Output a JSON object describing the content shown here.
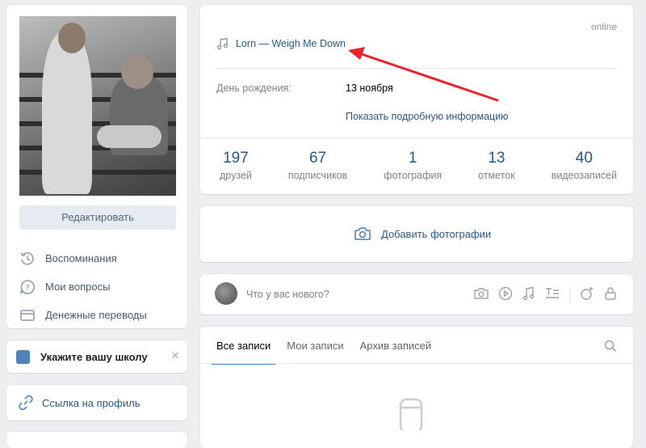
{
  "left": {
    "edit_button": "Редактировать",
    "menu": [
      {
        "label": "Воспоминания",
        "icon": "history-icon"
      },
      {
        "label": "Мои вопросы",
        "icon": "question-icon"
      },
      {
        "label": "Денежные переводы",
        "icon": "money-transfer-icon"
      }
    ],
    "school_prompt": "Укажите вашу школу",
    "profile_link": "Ссылка на профиль"
  },
  "profile": {
    "status": "online",
    "track": "Lorn — Weigh Me Down",
    "birthday_label": "День рождения:",
    "birthday_value": "13 ноября",
    "show_more": "Показать подробную информацию",
    "counters": [
      {
        "num": "197",
        "label": "друзей"
      },
      {
        "num": "67",
        "label": "подписчиков"
      },
      {
        "num": "1",
        "label": "фотография"
      },
      {
        "num": "13",
        "label": "отметок"
      },
      {
        "num": "40",
        "label": "видеозаписей"
      }
    ]
  },
  "add_photo": {
    "label": "Добавить фотографии"
  },
  "composer": {
    "placeholder": "Что у вас нового?"
  },
  "wall": {
    "tabs": [
      "Все записи",
      "Мои записи",
      "Архив записей"
    ]
  },
  "colors": {
    "accent": "#2a5885",
    "brand": "#5181b8",
    "arrow": "#e8252e"
  }
}
